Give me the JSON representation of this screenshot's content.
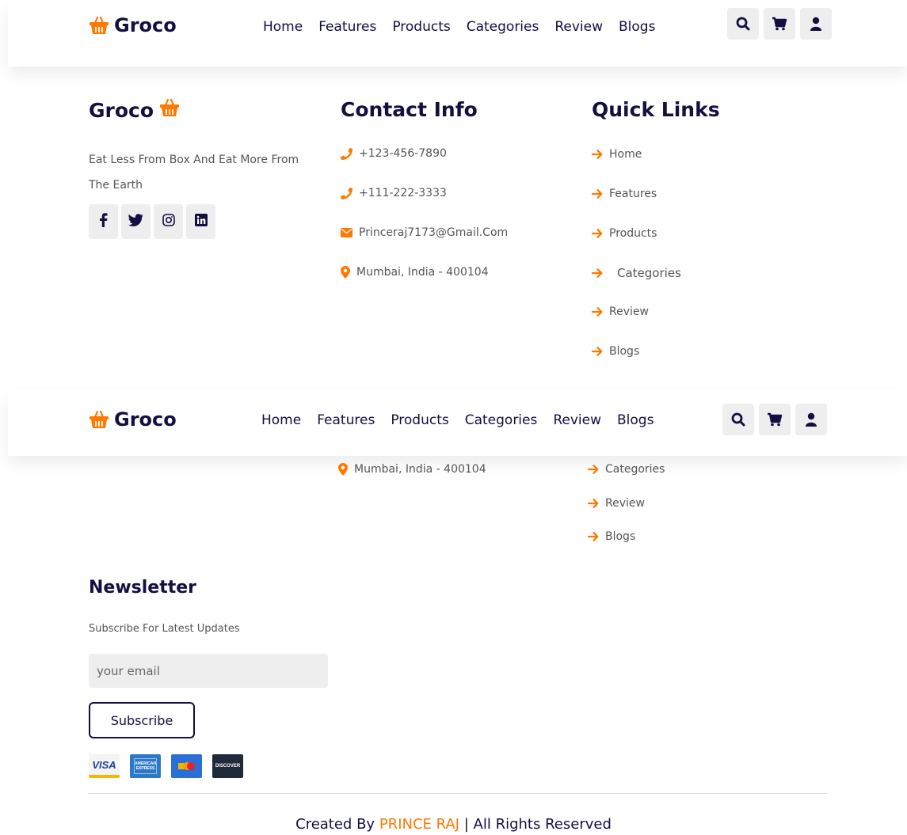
{
  "brand": "Groco",
  "nav": [
    "Home",
    "Features",
    "Products",
    "Categories",
    "Review",
    "Blogs"
  ],
  "header_icons": [
    "search-icon",
    "cart-icon",
    "user-icon"
  ],
  "footer": {
    "about": {
      "title": "Groco",
      "tagline": "Eat Less From Box And Eat More From The Earth",
      "socials": [
        "facebook-icon",
        "twitter-icon",
        "instagram-icon",
        "linkedin-icon"
      ]
    },
    "contact": {
      "title": "Contact Info",
      "items": [
        {
          "icon": "phone-icon",
          "text": "+123-456-7890"
        },
        {
          "icon": "phone-icon",
          "text": "+111-222-3333"
        },
        {
          "icon": "envelope-icon",
          "text": "Princeraj7173@Gmail.Com"
        },
        {
          "icon": "map-marker-icon",
          "text": "Mumbai, India - 400104"
        }
      ]
    },
    "quick_links": {
      "title": "Quick Links",
      "items": [
        "Home",
        "Features",
        "Products",
        "Categories",
        "Review",
        "Blogs"
      ]
    },
    "newsletter": {
      "title": "Newsletter",
      "subtitle": "Subscribe For Latest Updates",
      "placeholder": "your email",
      "button": "Subscribe"
    },
    "payment_cards": [
      "VISA",
      "AMERICAN EXPRESS",
      "mastercard",
      "DISCOVER"
    ],
    "credit": {
      "prefix": "Created By",
      "author": "PRINCE RAJ",
      "suffix": "| All Rights Reserved"
    }
  },
  "colors": {
    "accent": "#ff7800",
    "dark": "#130f40",
    "muted": "#555555",
    "panel": "#eeeeee"
  }
}
